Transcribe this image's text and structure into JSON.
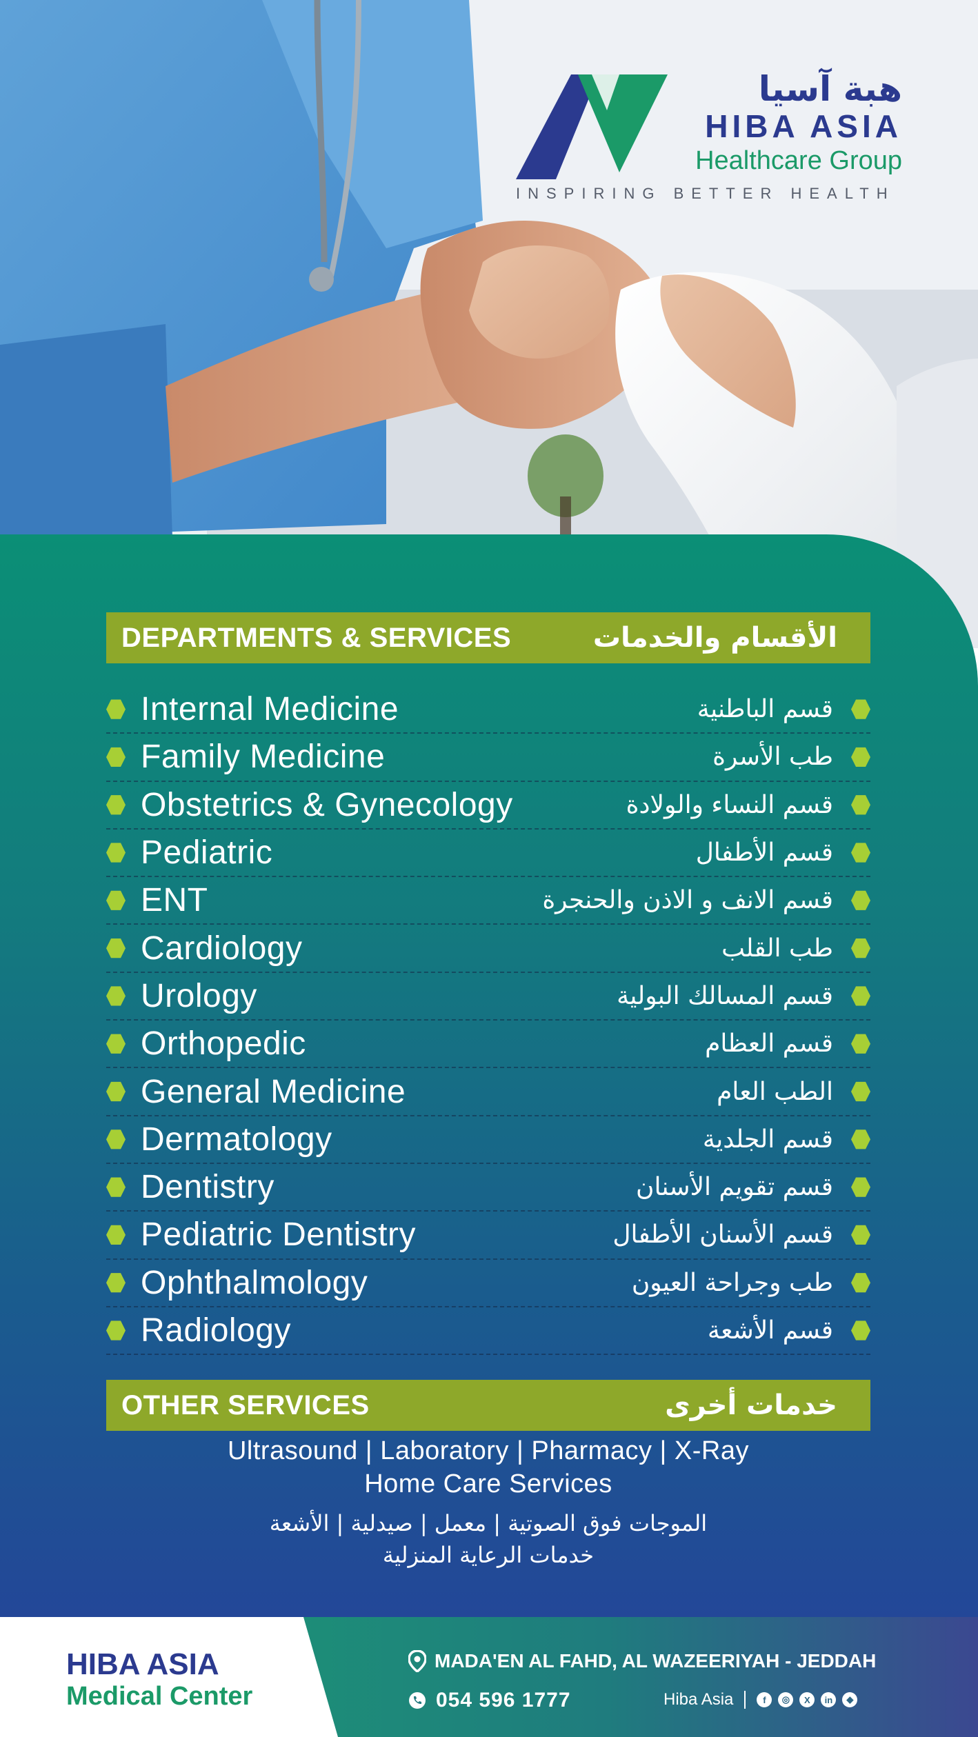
{
  "logo": {
    "arabic_name": "هبة آسيا",
    "name": "HIBA ASIA",
    "subtitle": "Healthcare Group",
    "tagline": "INSPIRING BETTER HEALTH"
  },
  "departments": {
    "heading_en": "DEPARTMENTS & SERVICES",
    "heading_ar": "الأقسام والخدمات",
    "items": [
      {
        "en": "Internal Medicine",
        "ar": "قسم الباطنية"
      },
      {
        "en": "Family Medicine",
        "ar": "طب الأسرة"
      },
      {
        "en": "Obstetrics & Gynecology",
        "ar": "قسم النساء والولادة"
      },
      {
        "en": "Pediatric",
        "ar": "قسم الأطفال"
      },
      {
        "en": "ENT",
        "ar": "قسم الانف و الاذن والحنجرة"
      },
      {
        "en": "Cardiology",
        "ar": "طب القلب"
      },
      {
        "en": "Urology",
        "ar": "قسم المسالك البولية"
      },
      {
        "en": "Orthopedic",
        "ar": "قسم العظام"
      },
      {
        "en": "General Medicine",
        "ar": "الطب العام"
      },
      {
        "en": "Dermatology",
        "ar": "قسم الجلدية"
      },
      {
        "en": "Dentistry",
        "ar": "قسم تقويم الأسنان"
      },
      {
        "en": "Pediatric Dentistry",
        "ar": "قسم الأسنان الأطفال"
      },
      {
        "en": "Ophthalmology",
        "ar": "طب وجراحة العيون"
      },
      {
        "en": "Radiology",
        "ar": "قسم الأشعة"
      }
    ]
  },
  "other_services": {
    "heading_en": "OTHER SERVICES",
    "heading_ar": "خدمات أخرى",
    "line_en_1": "Ultrasound | Laboratory | Pharmacy | X-Ray",
    "line_en_2": "Home Care Services",
    "line_ar_1": "الموجات فوق الصوتية | معمل | صيدلية | الأشعة",
    "line_ar_2": "خدمات الرعاية المنزلية"
  },
  "footer": {
    "brand_line1": "HIBA ASIA",
    "brand_line2": "Medical Center",
    "address": "MADA'EN AL FAHD, AL WAZEERIYAH - JEDDAH",
    "phone": "054 596 1777",
    "social_handle": "Hiba Asia",
    "social_icons": [
      "facebook-icon",
      "instagram-icon",
      "x-icon",
      "linkedin-icon",
      "snapchat-icon"
    ]
  },
  "colors": {
    "brand_blue": "#2b3a8f",
    "brand_green": "#1b9a68",
    "accent_olive": "#8ea82a",
    "bullet_lime": "#a7cf35",
    "panel_top": "#0b8f76",
    "panel_bottom": "#234798"
  }
}
